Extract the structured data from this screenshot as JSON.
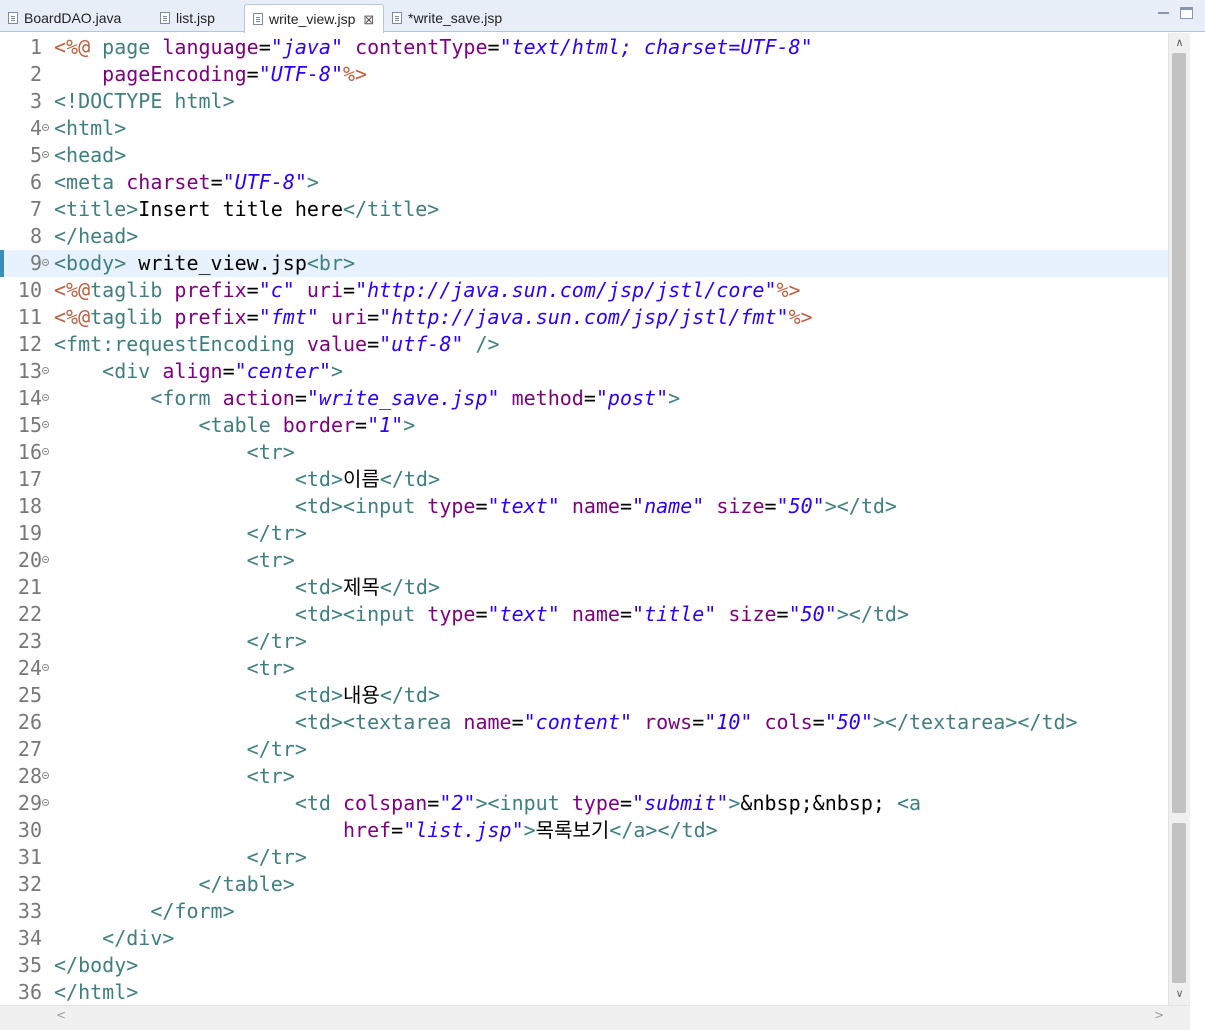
{
  "tabs": [
    {
      "label": "BoardDAO.java",
      "icon": "java-file-icon",
      "active": false
    },
    {
      "label": "list.jsp",
      "icon": "jsp-file-icon",
      "active": false
    },
    {
      "label": "write_view.jsp",
      "icon": "jsp-file-icon",
      "active": true,
      "close": "⊠"
    },
    {
      "label": "*write_save.jsp",
      "icon": "jsp-file-icon",
      "active": false
    }
  ],
  "colors": {
    "tag": "#3f7f7f",
    "attr": "#7f007f",
    "str": "#2a00ff",
    "delim": "#bf5f3f",
    "text": "#000000",
    "line_number": "#787878",
    "current_line": "#e8f2fe",
    "change_marker": "#3a8fb7"
  },
  "scroll": {
    "up": "∧",
    "down": "∨",
    "left": "<",
    "right": ">"
  },
  "lines": [
    {
      "n": "1",
      "fold": false,
      "toks": [
        [
          "<%@",
          "delim"
        ],
        [
          " ",
          "text"
        ],
        [
          "page",
          "tag"
        ],
        [
          " ",
          "text"
        ],
        [
          "language",
          "attr"
        ],
        [
          "=",
          "text"
        ],
        [
          "\"java\"",
          "str"
        ],
        [
          " ",
          "text"
        ],
        [
          "contentType",
          "attr"
        ],
        [
          "=",
          "text"
        ],
        [
          "\"text/html; charset=UTF-8\"",
          "str"
        ]
      ]
    },
    {
      "n": "2",
      "fold": false,
      "toks": [
        [
          "    ",
          "text"
        ],
        [
          "pageEncoding",
          "attr"
        ],
        [
          "=",
          "text"
        ],
        [
          "\"UTF-8\"",
          "str"
        ],
        [
          "%>",
          "delim"
        ]
      ]
    },
    {
      "n": "3",
      "fold": false,
      "toks": [
        [
          "<!DOCTYPE",
          "tag"
        ],
        [
          " ",
          "text"
        ],
        [
          "html",
          "tag"
        ],
        [
          ">",
          "tag"
        ]
      ]
    },
    {
      "n": "4",
      "fold": true,
      "toks": [
        [
          "<html>",
          "tag"
        ]
      ]
    },
    {
      "n": "5",
      "fold": true,
      "toks": [
        [
          "<head>",
          "tag"
        ]
      ]
    },
    {
      "n": "6",
      "fold": false,
      "toks": [
        [
          "<meta",
          "tag"
        ],
        [
          " ",
          "text"
        ],
        [
          "charset",
          "attr"
        ],
        [
          "=",
          "text"
        ],
        [
          "\"UTF-8\"",
          "str"
        ],
        [
          ">",
          "tag"
        ]
      ]
    },
    {
      "n": "7",
      "fold": false,
      "toks": [
        [
          "<title>",
          "tag"
        ],
        [
          "Insert title here",
          "text"
        ],
        [
          "</title>",
          "tag"
        ]
      ]
    },
    {
      "n": "8",
      "fold": false,
      "toks": [
        [
          "</head>",
          "tag"
        ]
      ]
    },
    {
      "n": "9",
      "fold": true,
      "current": true,
      "marker": true,
      "toks": [
        [
          "<body>",
          "tag"
        ],
        [
          " write_view.jsp",
          "text"
        ],
        [
          "<br>",
          "tag"
        ]
      ]
    },
    {
      "n": "10",
      "fold": false,
      "toks": [
        [
          "<%@",
          "delim"
        ],
        [
          "taglib",
          "tag"
        ],
        [
          " ",
          "text"
        ],
        [
          "prefix",
          "attr"
        ],
        [
          "=",
          "text"
        ],
        [
          "\"c\"",
          "str"
        ],
        [
          " ",
          "text"
        ],
        [
          "uri",
          "attr"
        ],
        [
          "=",
          "text"
        ],
        [
          "\"http://java.sun.com/jsp/jstl/core\"",
          "str"
        ],
        [
          "%>",
          "delim"
        ]
      ]
    },
    {
      "n": "11",
      "fold": false,
      "toks": [
        [
          "<%@",
          "delim"
        ],
        [
          "taglib",
          "tag"
        ],
        [
          " ",
          "text"
        ],
        [
          "prefix",
          "attr"
        ],
        [
          "=",
          "text"
        ],
        [
          "\"fmt\"",
          "str"
        ],
        [
          " ",
          "text"
        ],
        [
          "uri",
          "attr"
        ],
        [
          "=",
          "text"
        ],
        [
          "\"http://java.sun.com/jsp/jstl/fmt\"",
          "str"
        ],
        [
          "%>",
          "delim"
        ]
      ]
    },
    {
      "n": "12",
      "fold": false,
      "toks": [
        [
          "<fmt:requestEncoding",
          "tag"
        ],
        [
          " ",
          "text"
        ],
        [
          "value",
          "attr"
        ],
        [
          "=",
          "text"
        ],
        [
          "\"utf-8\"",
          "str"
        ],
        [
          " ",
          "text"
        ],
        [
          "/>",
          "tag"
        ]
      ]
    },
    {
      "n": "13",
      "fold": true,
      "toks": [
        [
          "    ",
          "text"
        ],
        [
          "<div",
          "tag"
        ],
        [
          " ",
          "text"
        ],
        [
          "align",
          "attr"
        ],
        [
          "=",
          "text"
        ],
        [
          "\"center\"",
          "str"
        ],
        [
          ">",
          "tag"
        ]
      ]
    },
    {
      "n": "14",
      "fold": true,
      "toks": [
        [
          "        ",
          "text"
        ],
        [
          "<form",
          "tag"
        ],
        [
          " ",
          "text"
        ],
        [
          "action",
          "attr"
        ],
        [
          "=",
          "text"
        ],
        [
          "\"write_save.jsp\"",
          "str"
        ],
        [
          " ",
          "text"
        ],
        [
          "method",
          "attr"
        ],
        [
          "=",
          "text"
        ],
        [
          "\"post\"",
          "str"
        ],
        [
          ">",
          "tag"
        ]
      ]
    },
    {
      "n": "15",
      "fold": true,
      "toks": [
        [
          "            ",
          "text"
        ],
        [
          "<table",
          "tag"
        ],
        [
          " ",
          "text"
        ],
        [
          "border",
          "attr"
        ],
        [
          "=",
          "text"
        ],
        [
          "\"1\"",
          "str"
        ],
        [
          ">",
          "tag"
        ]
      ]
    },
    {
      "n": "16",
      "fold": true,
      "toks": [
        [
          "                ",
          "text"
        ],
        [
          "<tr>",
          "tag"
        ]
      ]
    },
    {
      "n": "17",
      "fold": false,
      "toks": [
        [
          "                    ",
          "text"
        ],
        [
          "<td>",
          "tag"
        ],
        [
          "이름",
          "text"
        ],
        [
          "</td>",
          "tag"
        ]
      ]
    },
    {
      "n": "18",
      "fold": false,
      "toks": [
        [
          "                    ",
          "text"
        ],
        [
          "<td><input",
          "tag"
        ],
        [
          " ",
          "text"
        ],
        [
          "type",
          "attr"
        ],
        [
          "=",
          "text"
        ],
        [
          "\"text\"",
          "str"
        ],
        [
          " ",
          "text"
        ],
        [
          "name",
          "attr"
        ],
        [
          "=",
          "text"
        ],
        [
          "\"name\"",
          "str"
        ],
        [
          " ",
          "text"
        ],
        [
          "size",
          "attr"
        ],
        [
          "=",
          "text"
        ],
        [
          "\"50\"",
          "str"
        ],
        [
          "></td>",
          "tag"
        ]
      ]
    },
    {
      "n": "19",
      "fold": false,
      "toks": [
        [
          "                ",
          "text"
        ],
        [
          "</tr>",
          "tag"
        ]
      ]
    },
    {
      "n": "20",
      "fold": true,
      "toks": [
        [
          "                ",
          "text"
        ],
        [
          "<tr>",
          "tag"
        ]
      ]
    },
    {
      "n": "21",
      "fold": false,
      "toks": [
        [
          "                    ",
          "text"
        ],
        [
          "<td>",
          "tag"
        ],
        [
          "제목",
          "text"
        ],
        [
          "</td>",
          "tag"
        ]
      ]
    },
    {
      "n": "22",
      "fold": false,
      "toks": [
        [
          "                    ",
          "text"
        ],
        [
          "<td><input",
          "tag"
        ],
        [
          " ",
          "text"
        ],
        [
          "type",
          "attr"
        ],
        [
          "=",
          "text"
        ],
        [
          "\"text\"",
          "str"
        ],
        [
          " ",
          "text"
        ],
        [
          "name",
          "attr"
        ],
        [
          "=",
          "text"
        ],
        [
          "\"title\"",
          "str"
        ],
        [
          " ",
          "text"
        ],
        [
          "size",
          "attr"
        ],
        [
          "=",
          "text"
        ],
        [
          "\"50\"",
          "str"
        ],
        [
          "></td>",
          "tag"
        ]
      ]
    },
    {
      "n": "23",
      "fold": false,
      "toks": [
        [
          "                ",
          "text"
        ],
        [
          "</tr>",
          "tag"
        ]
      ]
    },
    {
      "n": "24",
      "fold": true,
      "toks": [
        [
          "                ",
          "text"
        ],
        [
          "<tr>",
          "tag"
        ]
      ]
    },
    {
      "n": "25",
      "fold": false,
      "toks": [
        [
          "                    ",
          "text"
        ],
        [
          "<td>",
          "tag"
        ],
        [
          "내용",
          "text"
        ],
        [
          "</td>",
          "tag"
        ]
      ]
    },
    {
      "n": "26",
      "fold": false,
      "toks": [
        [
          "                    ",
          "text"
        ],
        [
          "<td><textarea",
          "tag"
        ],
        [
          " ",
          "text"
        ],
        [
          "name",
          "attr"
        ],
        [
          "=",
          "text"
        ],
        [
          "\"content\"",
          "str"
        ],
        [
          " ",
          "text"
        ],
        [
          "rows",
          "attr"
        ],
        [
          "=",
          "text"
        ],
        [
          "\"10\"",
          "str"
        ],
        [
          " ",
          "text"
        ],
        [
          "cols",
          "attr"
        ],
        [
          "=",
          "text"
        ],
        [
          "\"50\"",
          "str"
        ],
        [
          "></textarea></td>",
          "tag"
        ]
      ]
    },
    {
      "n": "27",
      "fold": false,
      "toks": [
        [
          "                ",
          "text"
        ],
        [
          "</tr>",
          "tag"
        ]
      ]
    },
    {
      "n": "28",
      "fold": true,
      "toks": [
        [
          "                ",
          "text"
        ],
        [
          "<tr>",
          "tag"
        ]
      ]
    },
    {
      "n": "29",
      "fold": true,
      "toks": [
        [
          "                    ",
          "text"
        ],
        [
          "<td",
          "tag"
        ],
        [
          " ",
          "text"
        ],
        [
          "colspan",
          "attr"
        ],
        [
          "=",
          "text"
        ],
        [
          "\"2\"",
          "str"
        ],
        [
          "><input",
          "tag"
        ],
        [
          " ",
          "text"
        ],
        [
          "type",
          "attr"
        ],
        [
          "=",
          "text"
        ],
        [
          "\"submit\"",
          "str"
        ],
        [
          ">",
          "tag"
        ],
        [
          "&nbsp;&nbsp; ",
          "text"
        ],
        [
          "<a",
          "tag"
        ]
      ]
    },
    {
      "n": "30",
      "fold": false,
      "toks": [
        [
          "                        ",
          "text"
        ],
        [
          "href",
          "attr"
        ],
        [
          "=",
          "text"
        ],
        [
          "\"list.jsp\"",
          "str"
        ],
        [
          ">",
          "tag"
        ],
        [
          "목록보기",
          "text"
        ],
        [
          "</a></td>",
          "tag"
        ]
      ]
    },
    {
      "n": "31",
      "fold": false,
      "toks": [
        [
          "                ",
          "text"
        ],
        [
          "</tr>",
          "tag"
        ]
      ]
    },
    {
      "n": "32",
      "fold": false,
      "toks": [
        [
          "            ",
          "text"
        ],
        [
          "</table>",
          "tag"
        ]
      ]
    },
    {
      "n": "33",
      "fold": false,
      "toks": [
        [
          "        ",
          "text"
        ],
        [
          "</form>",
          "tag"
        ]
      ]
    },
    {
      "n": "34",
      "fold": false,
      "toks": [
        [
          "    ",
          "text"
        ],
        [
          "</div>",
          "tag"
        ]
      ]
    },
    {
      "n": "35",
      "fold": false,
      "toks": [
        [
          "</body>",
          "tag"
        ]
      ]
    },
    {
      "n": "36",
      "fold": false,
      "toks": [
        [
          "</html>",
          "tag"
        ]
      ]
    }
  ]
}
